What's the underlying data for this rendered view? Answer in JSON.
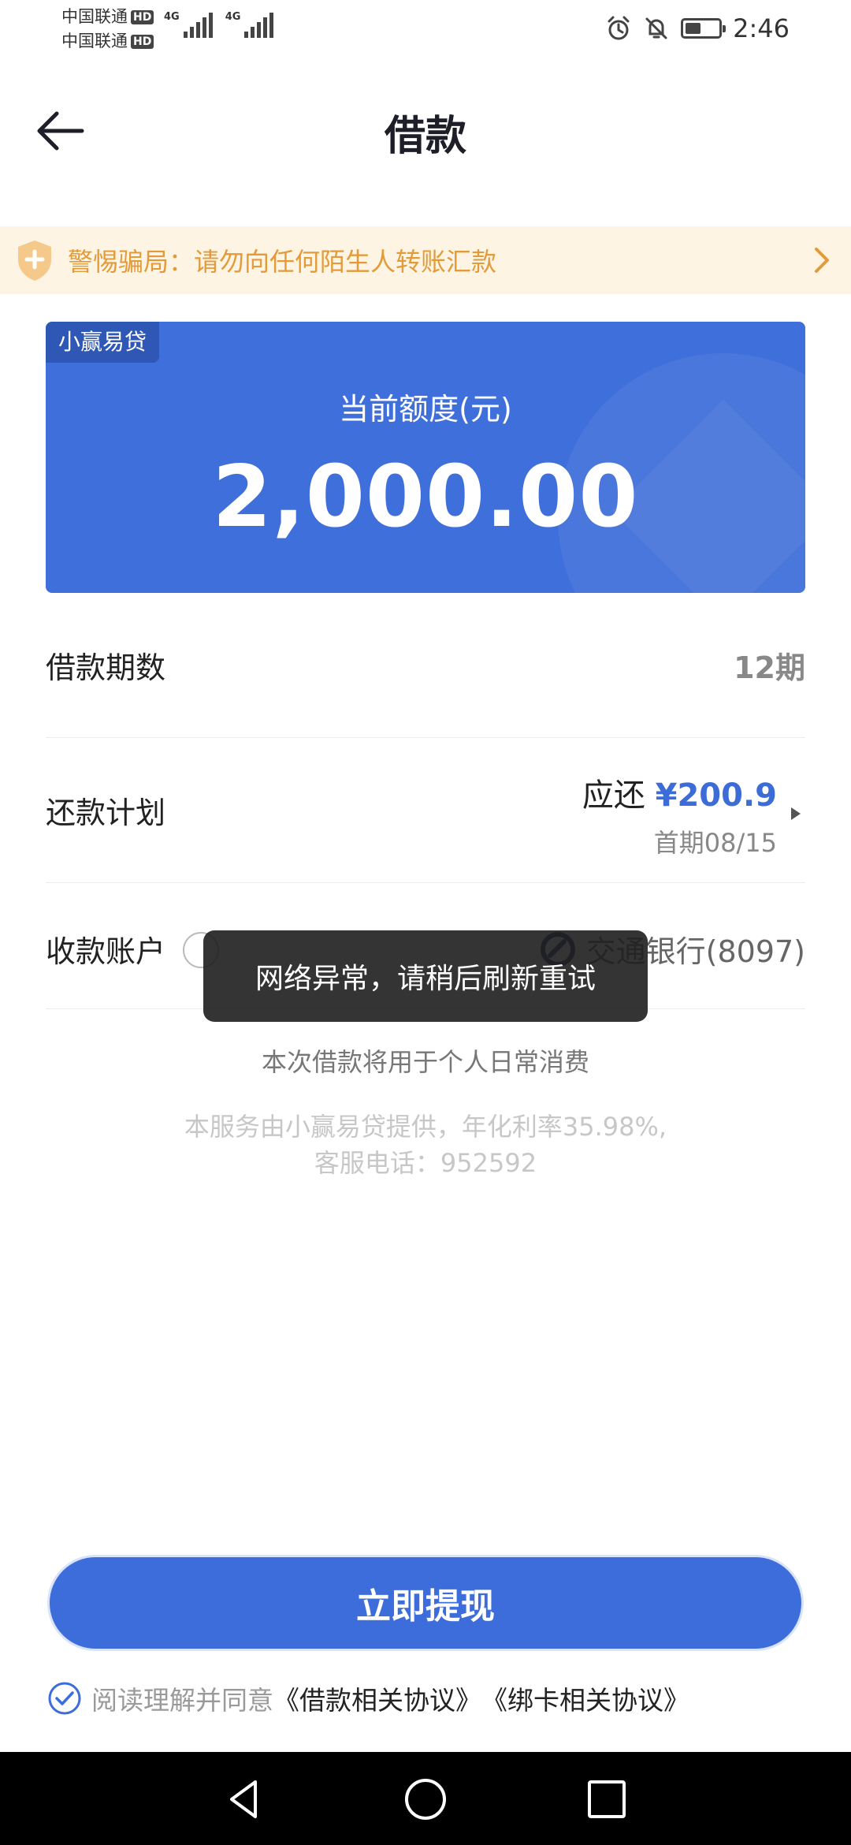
{
  "status_bar": {
    "carrier_1": "中国联通",
    "carrier_2": "中国联通",
    "hd_badge": "HD",
    "network_type": "4G",
    "time": "2:46"
  },
  "header": {
    "title": "借款",
    "back_icon": "arrow-left-icon"
  },
  "notice": {
    "text": "警惕骗局：请勿向任何陌生人转账汇款",
    "color": "#e39b3a"
  },
  "quota_card": {
    "tag": "小赢易贷",
    "label": "当前额度(元)",
    "amount": "2,000.00",
    "color": "#3f6fda"
  },
  "loan_terms": {
    "label": "借款期数",
    "value": "12期"
  },
  "repayment_plan": {
    "label": "还款计划",
    "due_prefix": "应还",
    "due_amount": "¥200.9",
    "first_period": "首期08/15"
  },
  "receiving_account": {
    "label": "收款账户",
    "bank": "交通银行(8097)"
  },
  "purpose_text": "本次借款将用于个人日常消费",
  "disclaimer": {
    "line1": "本服务由小赢易贷提供，年化利率35.98%,",
    "line2": "客服电话：952592"
  },
  "toast": {
    "message": "网络异常，请稍后刷新重试"
  },
  "primary_button": {
    "label": "立即提现",
    "color": "#3d6ddb"
  },
  "agreement": {
    "prefix": "阅读理解并同意",
    "loan_agreement": "《借款相关协议》",
    "card_agreement": "《绑卡相关协议》"
  }
}
